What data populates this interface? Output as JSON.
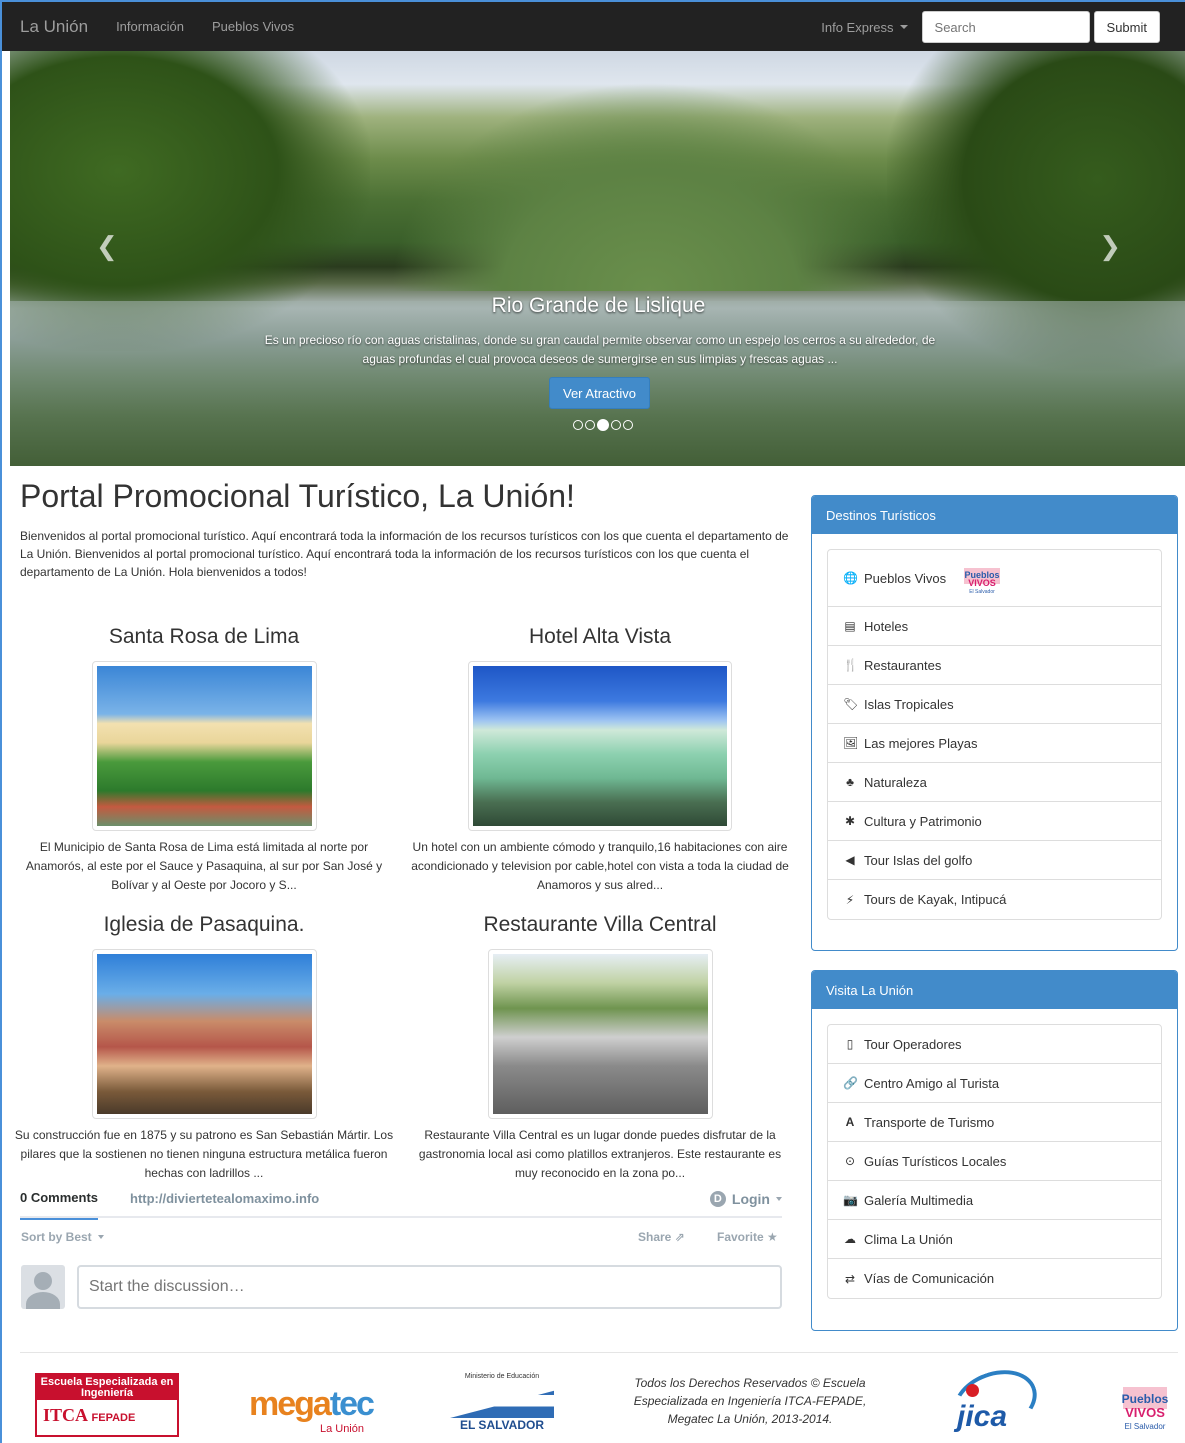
{
  "navbar": {
    "brand": "La Unión",
    "links": [
      "Información",
      "Pueblos Vivos"
    ],
    "dropdown": "Info Express",
    "search_placeholder": "Search",
    "submit_label": "Submit"
  },
  "carousel": {
    "title": "Rio Grande de Lislique",
    "text": "Es un precioso río con aguas cristalinas, donde su gran caudal permite observar como un espejo los cerros a su alrededor, de aguas profundas el cual provoca deseos de sumergirse en sus limpias y frescas aguas ...",
    "button": "Ver Atractivo",
    "prev_icon": "chevron-left-icon",
    "next_icon": "chevron-right-icon",
    "slide_count": 5,
    "active_slide": 3
  },
  "main": {
    "title": "Portal Promocional Turístico, La Unión!",
    "intro": "Bienvenidos al portal promocional turístico. Aquí encontrará toda la información de los recursos turísticos con los que cuenta el departamento de La Unión. Bienvenidos al portal promocional turístico. Aquí encontrará toda la información de los recursos turísticos con los que cuenta el departamento de La Unión. Hola bienvenidos a todos!"
  },
  "features": [
    {
      "title": "Santa Rosa de Lima",
      "text": "El Municipio de Santa Rosa de Lima está limitada al norte por Anamorós, al este por el Sauce y Pasaquina, al sur por San José y Bolívar y al Oeste por Jocoro y S..."
    },
    {
      "title": "Hotel Alta Vista",
      "text": "Un hotel con un ambiente cómodo y tranquilo,16 habitaciones con aire acondicionado y television por cable,hotel con vista a toda la ciudad de Anamoros y sus alred..."
    },
    {
      "title": "Iglesia de Pasaquina.",
      "text": "Su construcción fue en 1875 y su patrono es San Sebastián Mártir. Los pilares que la sostienen no tienen ninguna estructura metálica fueron hechas con ladrillos ..."
    },
    {
      "title": "Restaurante Villa Central",
      "text": "Restaurante Villa Central es un lugar donde puedes disfrutar de la gastronomia local asi como platillos extranjeros. Este restaurante es muy reconocido en la zona po..."
    }
  ],
  "comments": {
    "count_label": "0 Comments",
    "site_link": "http://diviertetealomaximo.info",
    "login": "Login",
    "disqus_glyph": "D",
    "sort": "Sort by Best",
    "share": "Share",
    "favorite": "Favorite",
    "placeholder": "Start the discussion…"
  },
  "sidebar": {
    "panel1": {
      "title": "Destinos Turísticos",
      "items": [
        {
          "label": "Pueblos Vivos",
          "icon": "globe-icon",
          "glyph": "🌐"
        },
        {
          "label": "Hoteles",
          "icon": "list-icon",
          "glyph": "▤"
        },
        {
          "label": "Restaurantes",
          "icon": "cutlery-icon",
          "glyph": "🍴"
        },
        {
          "label": "Islas Tropicales",
          "icon": "tags-icon",
          "glyph": "🏷"
        },
        {
          "label": "Las mejores Playas",
          "icon": "picture-icon",
          "glyph": "🖼"
        },
        {
          "label": "Naturaleza",
          "icon": "tree-icon",
          "glyph": "♣"
        },
        {
          "label": "Cultura y Patrimonio",
          "icon": "asterisk-icon",
          "glyph": "✱"
        },
        {
          "label": "Tour Islas del golfo",
          "icon": "send-icon",
          "glyph": "◀"
        },
        {
          "label": "Tours de Kayak, Intipucá",
          "icon": "flash-icon",
          "glyph": "⚡"
        }
      ]
    },
    "panel2": {
      "title": "Visita La Unión",
      "items": [
        {
          "label": "Tour Operadores",
          "icon": "phone-icon",
          "glyph": "▯"
        },
        {
          "label": "Centro Amigo al Turista",
          "icon": "link-icon",
          "glyph": "🔗"
        },
        {
          "label": "Transporte de Turismo",
          "icon": "road-icon",
          "glyph": "A"
        },
        {
          "label": "Guías Turísticos Locales",
          "icon": "record-icon",
          "glyph": "⊙"
        },
        {
          "label": "Galería Multimedia",
          "icon": "camera-icon",
          "glyph": "📷"
        },
        {
          "label": "Clima La Unión",
          "icon": "cloud-icon",
          "glyph": "☁"
        },
        {
          "label": "Vías de Comunicación",
          "icon": "transfer-icon",
          "glyph": "⇄"
        }
      ]
    }
  },
  "footer": {
    "itca_top": "Escuela Especializada en Ingeniería",
    "itca_main": "ITCA",
    "itca_fepade": "FEPADE",
    "mega_a": "mega",
    "mega_b": "tec",
    "mega_sub": "La Unión",
    "min_top": "Ministerio de Educación",
    "min_name": "EL SALVADOR",
    "copyright": "Todos los Derechos Reservados © Escuela Especializada en Ingeniería ITCA-FEPADE, Megatec La Unión, 2013-2014.",
    "jica": "jica"
  },
  "colors": {
    "navbar_bg": "#222222",
    "primary": "#428bca",
    "link_muted": "#9d9d9d"
  }
}
